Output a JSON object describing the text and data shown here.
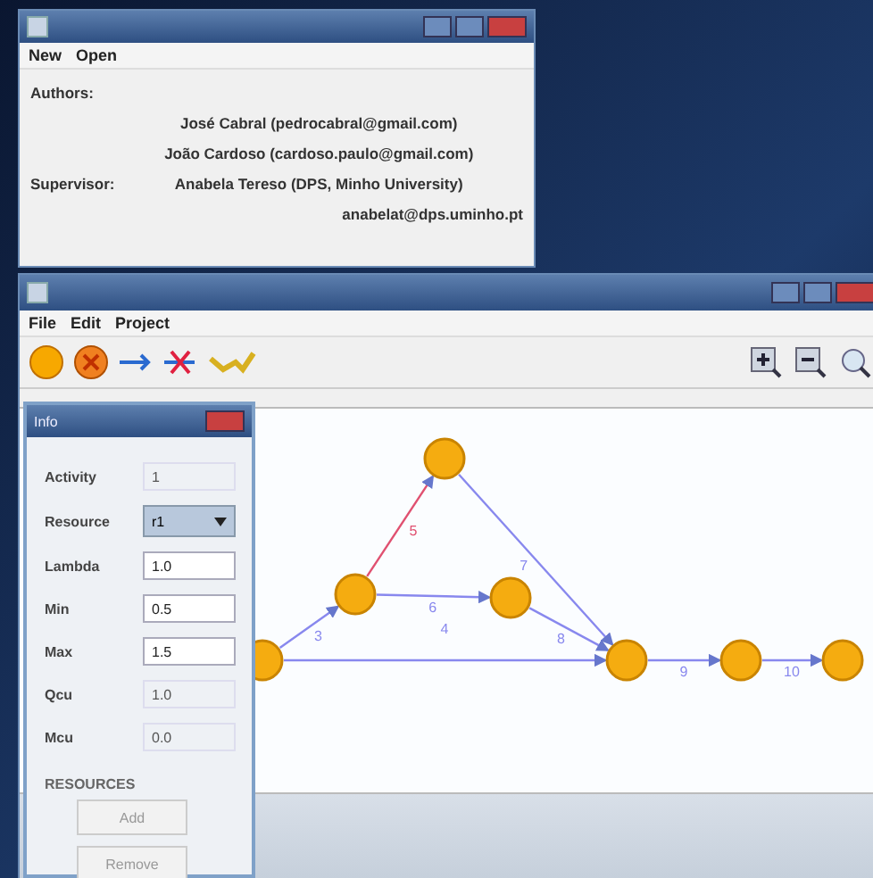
{
  "about_window": {
    "menu": [
      "New",
      "Open"
    ],
    "authors_label": "Authors:",
    "authors": [
      "José Cabral (pedrocabral@gmail.com)",
      "João Cardoso (cardoso.paulo@gmail.com)"
    ],
    "supervisor_label": "Supervisor:",
    "supervisor": [
      "Anabela Tereso (DPS, Minho University)",
      "anabelat@dps.uminho.pt"
    ]
  },
  "main_window": {
    "menu": [
      "File",
      "Edit",
      "Project"
    ],
    "graph": {
      "edges": [
        {
          "label": "3",
          "color": "#8888ee"
        },
        {
          "label": "5",
          "color": "#e05070"
        },
        {
          "label": "6",
          "color": "#8888ee"
        },
        {
          "label": "7",
          "color": "#8888ee"
        },
        {
          "label": "8",
          "color": "#8888ee"
        },
        {
          "label": "4",
          "color": "#8888ee"
        },
        {
          "label": "9",
          "color": "#8888ee"
        },
        {
          "label": "10",
          "color": "#8888ee"
        }
      ]
    }
  },
  "info_dialog": {
    "title": "Info",
    "fields": [
      {
        "label": "Activity",
        "value": "1",
        "kind": "readonly"
      },
      {
        "label": "Resource",
        "value": "r1",
        "kind": "select"
      },
      {
        "label": "Lambda",
        "value": "1.0",
        "kind": "input"
      },
      {
        "label": "Min",
        "value": "0.5",
        "kind": "input"
      },
      {
        "label": "Max",
        "value": "1.5",
        "kind": "input"
      },
      {
        "label": "Qcu",
        "value": "1.0",
        "kind": "readonly"
      },
      {
        "label": "Mcu",
        "value": "0.0",
        "kind": "readonly"
      }
    ],
    "section": "RESOURCES",
    "buttons": [
      {
        "label": "Add",
        "disabled": true
      },
      {
        "label": "Remove",
        "disabled": true
      }
    ]
  }
}
